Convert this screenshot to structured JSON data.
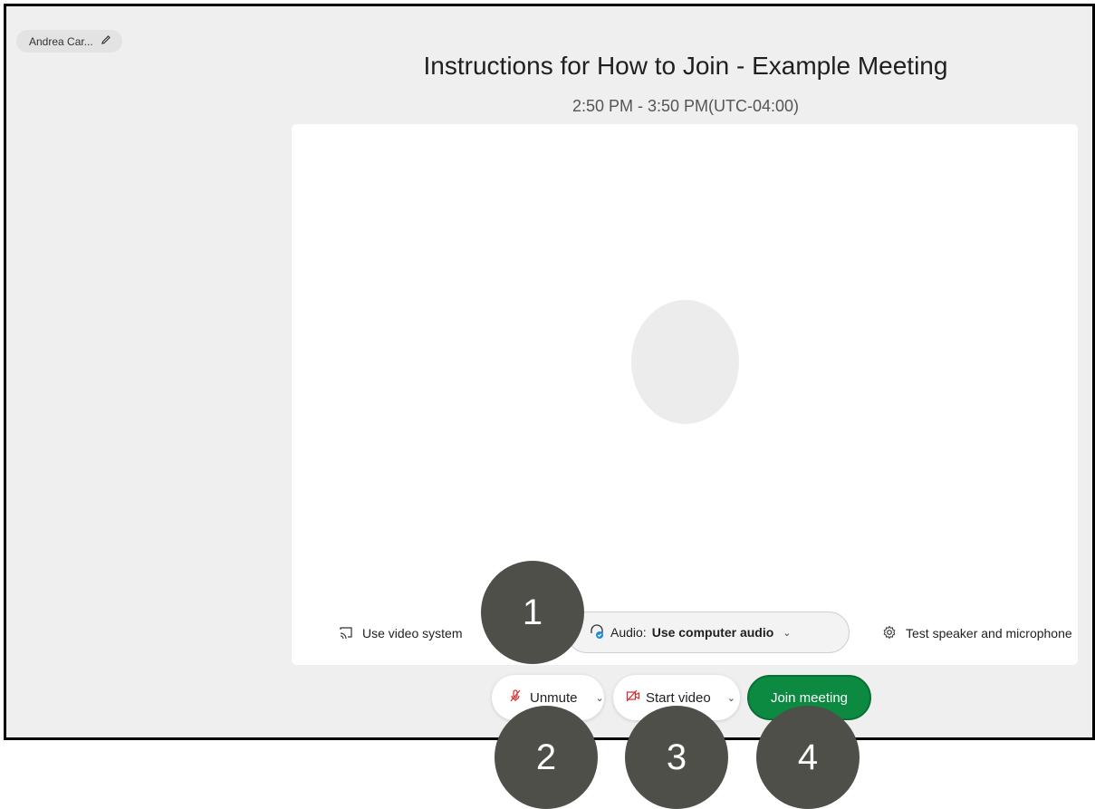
{
  "user": {
    "display_name": "Andrea Car...",
    "edit_icon": "pencil-icon"
  },
  "meeting": {
    "title": "Instructions for How to Join - Example Meeting",
    "time": "2:50 PM - 3:50 PM(UTC-04:00)"
  },
  "preview_bar": {
    "use_video_system": "Use video system",
    "audio_label": "Audio:",
    "audio_value": "Use computer audio",
    "test_speaker": "Test speaker and microphone"
  },
  "controls": {
    "unmute": "Unmute",
    "start_video": "Start video",
    "join": "Join meeting"
  },
  "markers": [
    "1",
    "2",
    "3",
    "4"
  ],
  "colors": {
    "join_green": "#0c8a41",
    "marker_gray": "#4d4f48",
    "muted_red": "#d62b2b",
    "headset_blue": "#1a8fd6"
  }
}
